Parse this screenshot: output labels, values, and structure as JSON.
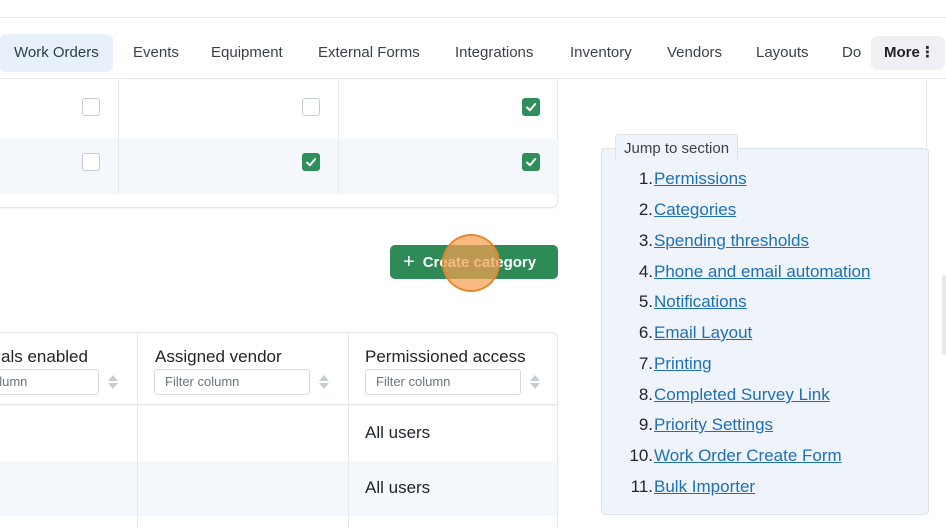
{
  "nav": {
    "tabs": [
      {
        "label": "Work Orders",
        "active": true
      },
      {
        "label": "Events"
      },
      {
        "label": "Equipment"
      },
      {
        "label": "External Forms"
      },
      {
        "label": "Integrations"
      },
      {
        "label": "Inventory"
      },
      {
        "label": "Vendors"
      },
      {
        "label": "Layouts"
      },
      {
        "label": "Do"
      }
    ],
    "more_label": "More",
    "more_icon": "kebab-vertical-icon"
  },
  "permissions_rows": [
    {
      "checks": [
        false,
        false,
        true
      ]
    },
    {
      "checks": [
        false,
        true,
        true
      ]
    }
  ],
  "create_button": {
    "label": "Create category",
    "icon": "plus-icon",
    "color": "#2e8b57"
  },
  "categories_table": {
    "columns": [
      {
        "title": "als enabled",
        "filter_placeholder": "olumn"
      },
      {
        "title": "Assigned vendor",
        "filter_placeholder": "Filter column"
      },
      {
        "title": "Permissioned access",
        "filter_placeholder": "Filter column"
      }
    ],
    "rows": [
      {
        "permissioned_access": "All users"
      },
      {
        "permissioned_access": "All users"
      }
    ]
  },
  "jump": {
    "legend": "Jump to section",
    "items": [
      {
        "num": "1.",
        "label": "Permissions"
      },
      {
        "num": "2.",
        "label": "Categories"
      },
      {
        "num": "3.",
        "label": "Spending thresholds"
      },
      {
        "num": "4.",
        "label": "Phone and email automation"
      },
      {
        "num": "5.",
        "label": "Notifications"
      },
      {
        "num": "6.",
        "label": "Email Layout"
      },
      {
        "num": "7.",
        "label": "Printing"
      },
      {
        "num": "8.",
        "label": "Completed Survey Link"
      },
      {
        "num": "9.",
        "label": "Priority Settings"
      },
      {
        "num": "10.",
        "label": "Work Order Create Form"
      },
      {
        "num": "11.",
        "label": "Bulk Importer"
      }
    ]
  },
  "colors": {
    "link": "#1f6fb2",
    "check": "#2f8f5b",
    "active_tab_bg": "#e8f1fb",
    "click_highlight": "#f5a050"
  }
}
